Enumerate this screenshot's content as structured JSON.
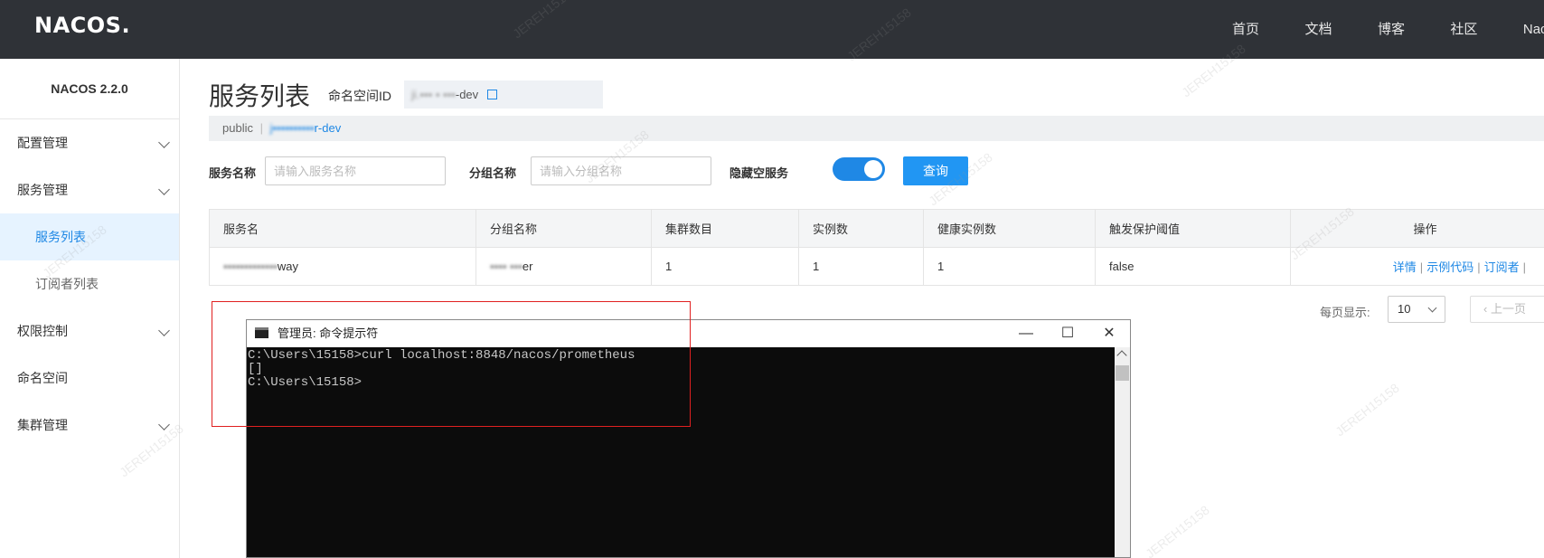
{
  "topbar": {
    "logo": "NACOS.",
    "nav": [
      "首页",
      "文档",
      "博客",
      "社区",
      "Nacos企业版"
    ]
  },
  "sidebar": {
    "version": "NACOS 2.2.0",
    "items": [
      {
        "label": "配置管理",
        "expandable": true
      },
      {
        "label": "服务管理",
        "expandable": true
      },
      {
        "label": "服务列表",
        "sub": true,
        "active": true
      },
      {
        "label": "订阅者列表",
        "sub": true
      },
      {
        "label": "权限控制",
        "expandable": true
      },
      {
        "label": "命名空间",
        "expandable": false
      },
      {
        "label": "集群管理",
        "expandable": true
      }
    ]
  },
  "header": {
    "title": "服务列表",
    "namespace_label": "命名空间ID",
    "namespace_value_blurred": "ji.▪▪▪ ▪ ▪▪▪",
    "namespace_value_suffix": "-dev",
    "ns_bar_public": "public",
    "ns_bar_sep": "|",
    "ns_bar_blurred": "j▪▪▪▪▪▪▪▪▪▪",
    "ns_bar_suffix": "r-dev"
  },
  "filter": {
    "service_name_label": "服务名称",
    "service_name_placeholder": "请输入服务名称",
    "group_name_label": "分组名称",
    "group_name_placeholder": "请输入分组名称",
    "hide_empty_label": "隐藏空服务",
    "hide_empty_on": true,
    "query_button": "查询"
  },
  "table": {
    "columns": [
      "服务名",
      "分组名称",
      "集群数目",
      "实例数",
      "健康实例数",
      "触发保护阈值",
      "操作"
    ],
    "rows": [
      {
        "service_blurred": "▪▪▪▪▪▪▪▪▪▪▪▪▪",
        "service_suffix": "way",
        "group_blurred": "▪▪▪▪ ▪▪▪",
        "group_suffix": "er",
        "clusters": "1",
        "instances": "1",
        "healthy": "1",
        "threshold": "false",
        "ops": [
          "详情",
          "示例代码",
          "订阅者"
        ]
      }
    ]
  },
  "pager": {
    "per_page_label": "每页显示:",
    "per_page_value": "10",
    "prev_label": "上一页"
  },
  "cmd": {
    "title": "管理员: 命令提示符",
    "minimize": "—",
    "maximize": "☐",
    "close": "✕",
    "lines": [
      "C:\\Users\\15158>curl localhost:8848/nacos/prometheus",
      "[]",
      "C:\\Users\\15158>"
    ]
  },
  "watermark": "JEREH15158",
  "colors": {
    "topbar_bg": "#2f3237",
    "accent": "#1f88e5",
    "annotation_red": "#e02020",
    "terminal_bg": "#0c0c0c"
  }
}
